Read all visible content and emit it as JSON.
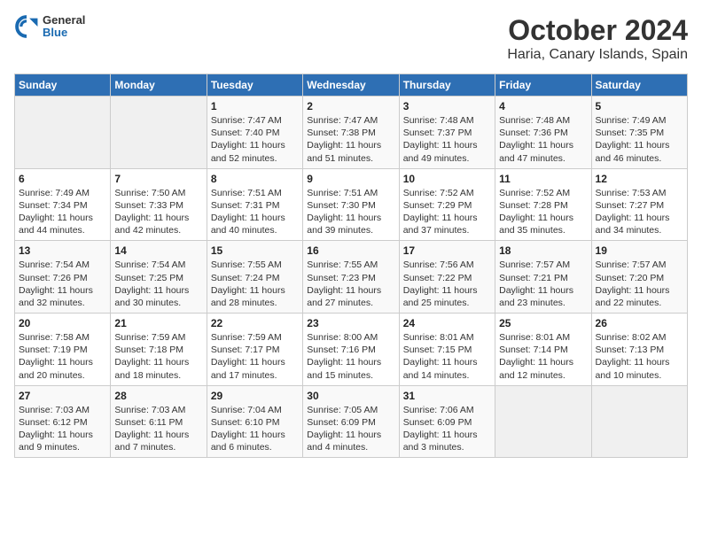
{
  "header": {
    "logo": {
      "general": "General",
      "blue": "Blue"
    },
    "title": "October 2024",
    "subtitle": "Haria, Canary Islands, Spain"
  },
  "weekdays": [
    "Sunday",
    "Monday",
    "Tuesday",
    "Wednesday",
    "Thursday",
    "Friday",
    "Saturday"
  ],
  "weeks": [
    [
      null,
      null,
      {
        "day": 1,
        "sunrise": "7:47 AM",
        "sunset": "7:40 PM",
        "daylight": "11 hours and 52 minutes."
      },
      {
        "day": 2,
        "sunrise": "7:47 AM",
        "sunset": "7:38 PM",
        "daylight": "11 hours and 51 minutes."
      },
      {
        "day": 3,
        "sunrise": "7:48 AM",
        "sunset": "7:37 PM",
        "daylight": "11 hours and 49 minutes."
      },
      {
        "day": 4,
        "sunrise": "7:48 AM",
        "sunset": "7:36 PM",
        "daylight": "11 hours and 47 minutes."
      },
      {
        "day": 5,
        "sunrise": "7:49 AM",
        "sunset": "7:35 PM",
        "daylight": "11 hours and 46 minutes."
      }
    ],
    [
      {
        "day": 6,
        "sunrise": "7:49 AM",
        "sunset": "7:34 PM",
        "daylight": "11 hours and 44 minutes."
      },
      {
        "day": 7,
        "sunrise": "7:50 AM",
        "sunset": "7:33 PM",
        "daylight": "11 hours and 42 minutes."
      },
      {
        "day": 8,
        "sunrise": "7:51 AM",
        "sunset": "7:31 PM",
        "daylight": "11 hours and 40 minutes."
      },
      {
        "day": 9,
        "sunrise": "7:51 AM",
        "sunset": "7:30 PM",
        "daylight": "11 hours and 39 minutes."
      },
      {
        "day": 10,
        "sunrise": "7:52 AM",
        "sunset": "7:29 PM",
        "daylight": "11 hours and 37 minutes."
      },
      {
        "day": 11,
        "sunrise": "7:52 AM",
        "sunset": "7:28 PM",
        "daylight": "11 hours and 35 minutes."
      },
      {
        "day": 12,
        "sunrise": "7:53 AM",
        "sunset": "7:27 PM",
        "daylight": "11 hours and 34 minutes."
      }
    ],
    [
      {
        "day": 13,
        "sunrise": "7:54 AM",
        "sunset": "7:26 PM",
        "daylight": "11 hours and 32 minutes."
      },
      {
        "day": 14,
        "sunrise": "7:54 AM",
        "sunset": "7:25 PM",
        "daylight": "11 hours and 30 minutes."
      },
      {
        "day": 15,
        "sunrise": "7:55 AM",
        "sunset": "7:24 PM",
        "daylight": "11 hours and 28 minutes."
      },
      {
        "day": 16,
        "sunrise": "7:55 AM",
        "sunset": "7:23 PM",
        "daylight": "11 hours and 27 minutes."
      },
      {
        "day": 17,
        "sunrise": "7:56 AM",
        "sunset": "7:22 PM",
        "daylight": "11 hours and 25 minutes."
      },
      {
        "day": 18,
        "sunrise": "7:57 AM",
        "sunset": "7:21 PM",
        "daylight": "11 hours and 23 minutes."
      },
      {
        "day": 19,
        "sunrise": "7:57 AM",
        "sunset": "7:20 PM",
        "daylight": "11 hours and 22 minutes."
      }
    ],
    [
      {
        "day": 20,
        "sunrise": "7:58 AM",
        "sunset": "7:19 PM",
        "daylight": "11 hours and 20 minutes."
      },
      {
        "day": 21,
        "sunrise": "7:59 AM",
        "sunset": "7:18 PM",
        "daylight": "11 hours and 18 minutes."
      },
      {
        "day": 22,
        "sunrise": "7:59 AM",
        "sunset": "7:17 PM",
        "daylight": "11 hours and 17 minutes."
      },
      {
        "day": 23,
        "sunrise": "8:00 AM",
        "sunset": "7:16 PM",
        "daylight": "11 hours and 15 minutes."
      },
      {
        "day": 24,
        "sunrise": "8:01 AM",
        "sunset": "7:15 PM",
        "daylight": "11 hours and 14 minutes."
      },
      {
        "day": 25,
        "sunrise": "8:01 AM",
        "sunset": "7:14 PM",
        "daylight": "11 hours and 12 minutes."
      },
      {
        "day": 26,
        "sunrise": "8:02 AM",
        "sunset": "7:13 PM",
        "daylight": "11 hours and 10 minutes."
      }
    ],
    [
      {
        "day": 27,
        "sunrise": "7:03 AM",
        "sunset": "6:12 PM",
        "daylight": "11 hours and 9 minutes."
      },
      {
        "day": 28,
        "sunrise": "7:03 AM",
        "sunset": "6:11 PM",
        "daylight": "11 hours and 7 minutes."
      },
      {
        "day": 29,
        "sunrise": "7:04 AM",
        "sunset": "6:10 PM",
        "daylight": "11 hours and 6 minutes."
      },
      {
        "day": 30,
        "sunrise": "7:05 AM",
        "sunset": "6:09 PM",
        "daylight": "11 hours and 4 minutes."
      },
      {
        "day": 31,
        "sunrise": "7:06 AM",
        "sunset": "6:09 PM",
        "daylight": "11 hours and 3 minutes."
      },
      null,
      null
    ]
  ]
}
